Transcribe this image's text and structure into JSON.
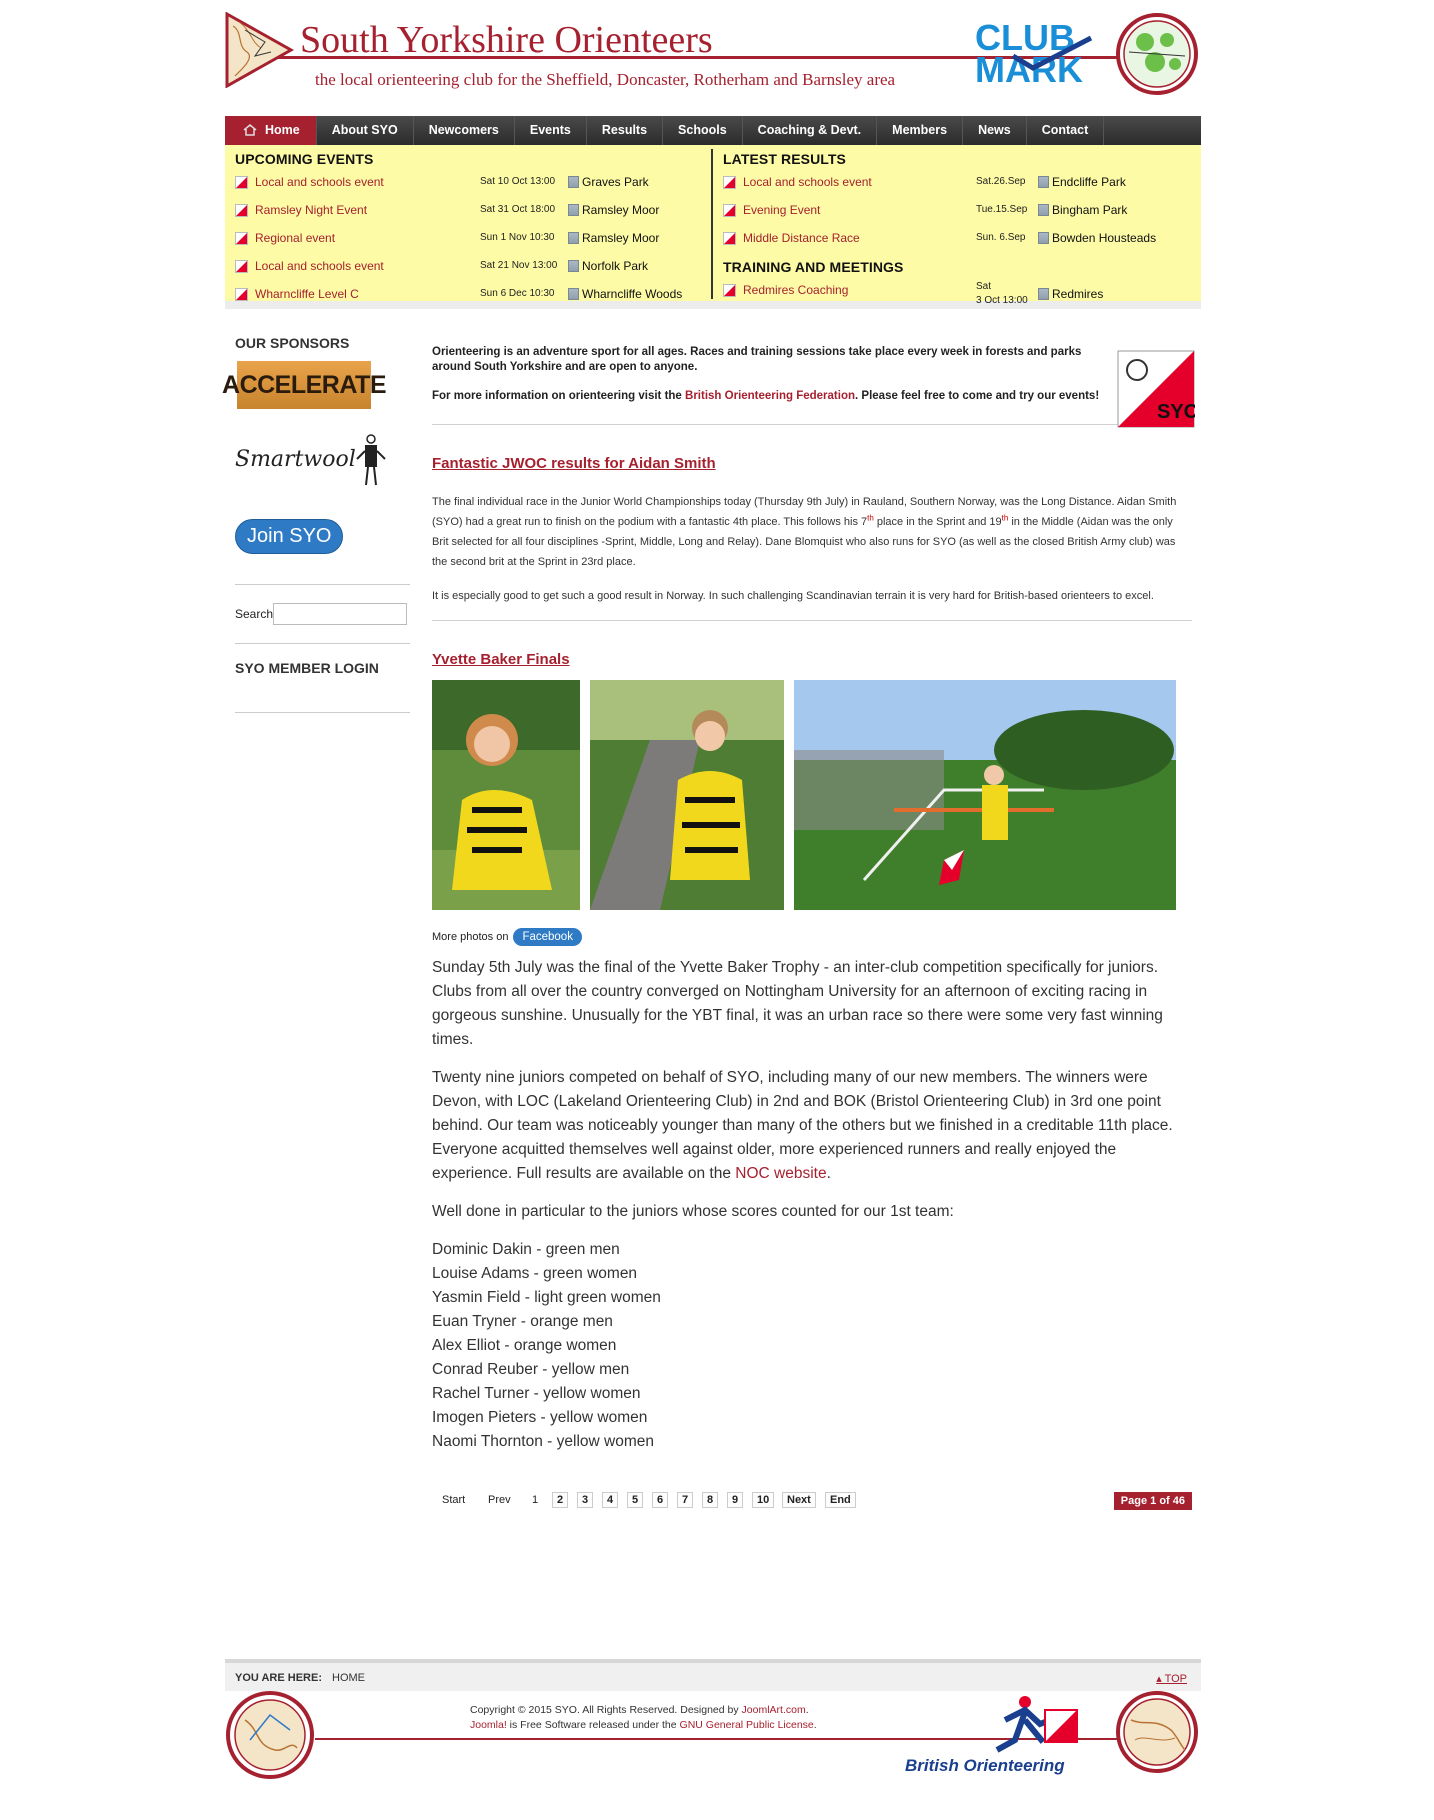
{
  "header": {
    "title": "South Yorkshire Orienteers",
    "tagline": "the local orienteering club for the Sheffield, Doncaster, Rotherham and Barnsley area",
    "clubmark_line1": "CLUB",
    "clubmark_line2": "MARK"
  },
  "nav": {
    "items": [
      "Home",
      "About SYO",
      "Newcomers",
      "Events",
      "Results",
      "Schools",
      "Coaching & Devt.",
      "Members",
      "News",
      "Contact"
    ]
  },
  "upcoming": {
    "heading": "UPCOMING EVENTS",
    "rows": [
      {
        "name": "Local and schools event",
        "date": "Sat 10 Oct 13:00",
        "venue": "Graves Park"
      },
      {
        "name": "Ramsley Night Event",
        "date": "Sat 31 Oct 18:00",
        "venue": "Ramsley Moor"
      },
      {
        "name": "Regional event",
        "date": "Sun  1 Nov 10:30",
        "venue": "Ramsley Moor"
      },
      {
        "name": "Local and schools event",
        "date": "Sat 21 Nov 13:00",
        "venue": "Norfolk Park"
      },
      {
        "name": "Wharncliffe Level C",
        "date": "Sun  6 Dec 10:30",
        "venue": "Wharncliffe Woods"
      }
    ]
  },
  "results": {
    "heading": "LATEST RESULTS",
    "rows": [
      {
        "name": "Local and schools event",
        "date": "Sat.26.Sep",
        "venue": "Endcliffe Park"
      },
      {
        "name": "Evening Event",
        "date": "Tue.15.Sep",
        "venue": "Bingham Park"
      },
      {
        "name": "Middle Distance Race",
        "date": "Sun. 6.Sep",
        "venue": "Bowden Housteads"
      }
    ]
  },
  "training": {
    "heading": "TRAINING AND MEETINGS",
    "rows": [
      {
        "name": "Redmires Coaching",
        "date_line1": "Sat",
        "date_line2": "3 Oct  13:00",
        "venue": "Redmires"
      }
    ]
  },
  "sidebar": {
    "sponsors_title": "OUR SPONSORS",
    "sponsor1": "ACCELERATE",
    "sponsor2": "Smartwool",
    "join_label": "Join SYO",
    "search_label": "Search",
    "search_value": "",
    "login_title": "SYO MEMBER LOGIN"
  },
  "intro": {
    "p1": "Orienteering is an adventure sport for all ages. Races and training sessions take place every week in forests and parks around South Yorkshire and are open to anyone.",
    "p2_before": "For more information on orienteering visit the ",
    "p2_link": "British Orienteering Federation",
    "p2_after": ". Please feel free to come and try our events!",
    "logo_text": "SYO"
  },
  "article1": {
    "title": "Fantastic JWOC results for Aidan Smith",
    "p1_a": "The final individual race in the Junior World Championships today (Thursday 9th July) in Rauland, Southern Norway, was the Long Distance. Aidan Smith (SYO) had a great run to finish on the podium with a fantastic 4th place.  This follows his 7",
    "p1_sup1": "th",
    "p1_b": " place in the Sprint and 19",
    "p1_sup2": "th",
    "p1_c": " in the Middle (Aidan was the only Brit selected for all four disciplines -Sprint, Middle, Long and Relay). Dane Blomquist who also runs for SYO (as well as the closed British Army club) was the second brit at the Sprint in 23rd place.",
    "p2": "It is especially good to get such a good result in Norway. In such challenging Scandinavian terrain it is very hard for British-based orienteers to excel."
  },
  "article2": {
    "title": "Yvette Baker Finals",
    "more_photos": "More photos on",
    "facebook": "Facebook",
    "p1": "Sunday 5th July was the final of the Yvette Baker Trophy - an inter-club competition specifically for juniors. Clubs from all over the country converged on Nottingham University for an afternoon of exciting racing in gorgeous sunshine. Unusually for the YBT final, it was an urban race so there were some very fast winning times.",
    "p2_before": "Twenty nine juniors competed on behalf of SYO, including many of our new members. The winners were Devon, with LOC (Lakeland Orienteering Club) in 2nd and BOK (Bristol Orienteering Club) in 3rd one point behind. Our team was noticeably younger than many of the others but we finished in a creditable 11th place.  Everyone acquitted themselves well against older, more experienced runners and really enjoyed the experience. Full results are available on the ",
    "p2_link": "NOC website",
    "p2_after": ".",
    "p3": "Well done in particular to the juniors whose scores counted for our 1st team:",
    "juniors": [
      "Dominic Dakin - green men",
      "Louise Adams - green women",
      "Yasmin Field - light green women",
      "Euan Tryner - orange men",
      "Alex Elliot - orange women",
      "Conrad Reuber - yellow men",
      "Rachel Turner - yellow women",
      "Imogen Pieters - yellow women",
      "Naomi Thornton - yellow women"
    ]
  },
  "pager": {
    "start": "Start",
    "prev": "Prev",
    "current": "1",
    "pages": [
      "2",
      "3",
      "4",
      "5",
      "6",
      "7",
      "8",
      "9",
      "10"
    ],
    "next": "Next",
    "end": "End",
    "page_of": "Page 1 of 46"
  },
  "footer": {
    "you_are_here": "YOU ARE HERE:",
    "breadcrumb": "HOME",
    "top": "TOP",
    "copy_a": "Copyright © 2015 SYO. All Rights Reserved. Designed by ",
    "copy_link1": "JoomlArt.com",
    "copy_b": ".",
    "copy_link2": "Joomla!",
    "copy_c": " is Free Software released under the ",
    "copy_link3": "GNU General Public License",
    "copy_d": ".",
    "bof": "British Orienteering"
  },
  "colors": {
    "brand": "#a6212f",
    "panel": "#fdfba6",
    "accent": "#2e7ac4"
  }
}
